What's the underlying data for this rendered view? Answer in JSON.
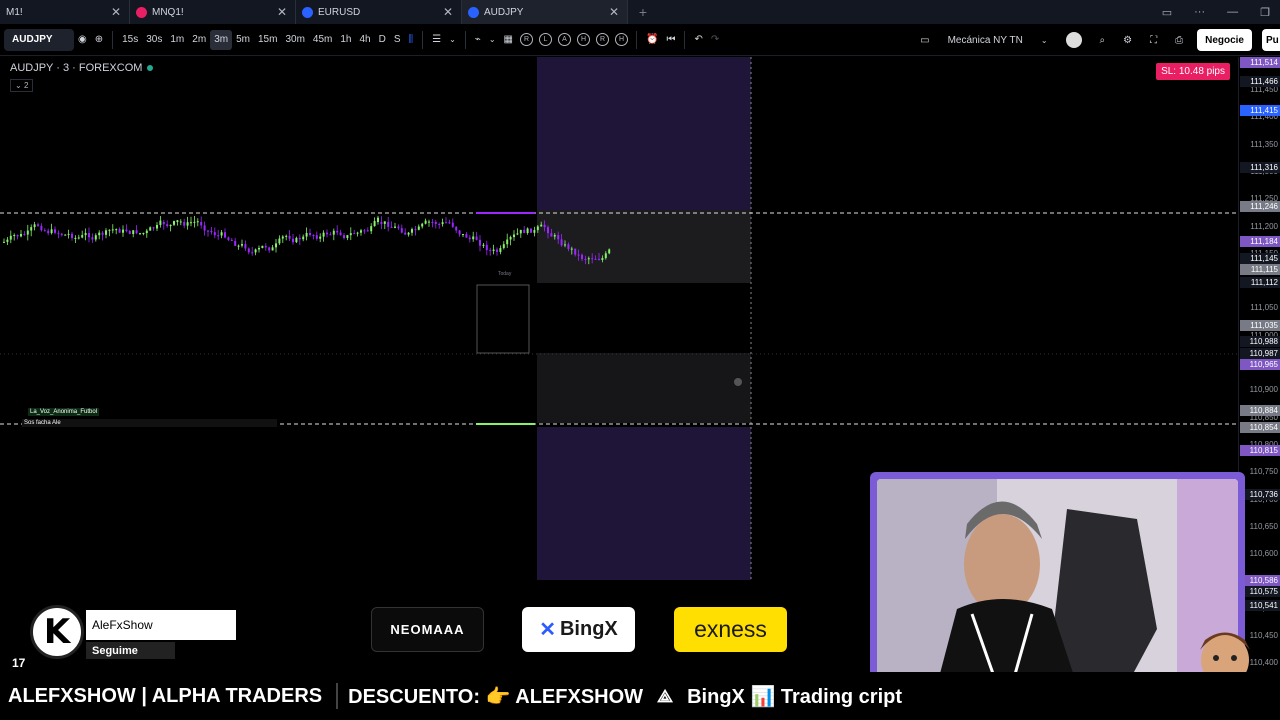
{
  "tabs": [
    {
      "label": "M1!",
      "color": "#2962ff"
    },
    {
      "label": "MNQ1!",
      "color": "#e91e63"
    },
    {
      "label": "EURUSD",
      "color": "#2962ff"
    },
    {
      "label": "AUDJPY",
      "color": "#2962ff"
    }
  ],
  "toolbar": {
    "symbol": "AUDJPY",
    "intervals": [
      "15s",
      "30s",
      "1m",
      "2m",
      "3m",
      "5m",
      "15m",
      "30m",
      "45m",
      "1h",
      "4h",
      "D",
      "S"
    ],
    "selected_interval": "3m",
    "replay_buttons": [
      "R",
      "L",
      "A",
      "H",
      "R",
      "H"
    ],
    "layout_name": "Mecánica NY TN",
    "trade_label": "Negocie",
    "publish_label": "Pu"
  },
  "chart": {
    "symbol_title": "AUDJPY · 3 · FOREXCOM",
    "collapse_label": "2",
    "sl_badge": "SL: 10.48 pips",
    "indicator_label_1": "La_Voz_Anonima_Futbol",
    "indicator_label_2": "Sos facha Ale",
    "today_label": "Today"
  },
  "price_axis": {
    "ticks": [
      "111,450",
      "111,400",
      "111,350",
      "111,300",
      "111,250",
      "111,200",
      "111,150",
      "111,100",
      "111,050",
      "111,000",
      "110,950",
      "110,900",
      "110,850",
      "110,800",
      "110,750",
      "110,700",
      "110,650",
      "110,600",
      "110,550",
      "110,500",
      "110,450",
      "110,400"
    ],
    "tags": [
      {
        "label": "111,514",
        "color": "#7e57c2"
      },
      {
        "label": "111,466",
        "color": "#131722"
      },
      {
        "label": "111,415",
        "color": "#2962ff"
      },
      {
        "label": "111,316",
        "color": "#131722"
      },
      {
        "label": "111,246",
        "color": "#787b86"
      },
      {
        "label": "111,184",
        "color": "#7e57c2"
      },
      {
        "label": "111,145",
        "color": "#131722"
      },
      {
        "label": "111,115",
        "color": "#787b86"
      },
      {
        "label": "111,112",
        "color": "#131722"
      },
      {
        "label": "111,035",
        "color": "#787b86"
      },
      {
        "label": "110,988",
        "color": "#131722"
      },
      {
        "label": "110,987",
        "color": "#131722"
      },
      {
        "label": "110,965",
        "color": "#7e57c2"
      },
      {
        "label": "110,884",
        "color": "#787b86"
      },
      {
        "label": "110,854",
        "color": "#787b86"
      },
      {
        "label": "110,815",
        "color": "#7e57c2"
      },
      {
        "label": "110,736",
        "color": "#131722"
      },
      {
        "label": "110,586",
        "color": "#7e57c2"
      },
      {
        "label": "110,575",
        "color": "#131722"
      },
      {
        "label": "110,541",
        "color": "#131722"
      }
    ]
  },
  "overlay": {
    "kick_name": "AleFxShow",
    "kick_follow": "Seguime",
    "sponsors": [
      "NEOMAAA",
      "BingX",
      "exness"
    ],
    "ticker": [
      "ALEFXSHOW | ALPHA TRADERS",
      "DESCUENTO: 👉 ALEFXSHOW",
      "BingX 📊 Trading cript"
    ]
  },
  "colors": {
    "bull": "#86f26b",
    "bear": "#9c27ff",
    "zone_purple": "#1e1538",
    "zone_gray": "#1e1f22"
  }
}
